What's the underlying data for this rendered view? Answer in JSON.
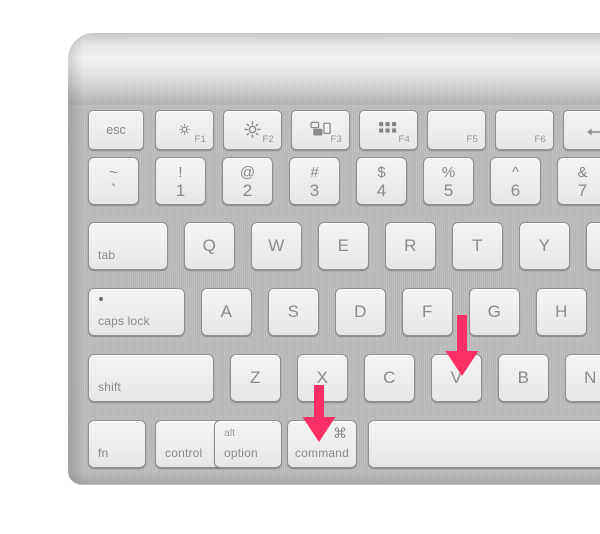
{
  "scene": {
    "subject": "apple-wireless-keyboard",
    "background_color": "#ffffff",
    "body_color": "#c4c4c5",
    "key_color": "#eeeeef",
    "legend_color": "#8a8a8c",
    "annotation_color": "#fb2f65"
  },
  "annotations": [
    {
      "name": "arrow-to-v-key",
      "points_to": "V",
      "direction": "down",
      "color": "#fb2f65"
    },
    {
      "name": "arrow-to-command-key",
      "points_to": "command",
      "direction": "down",
      "color": "#fb2f65"
    }
  ],
  "rows": {
    "function_row": [
      {
        "name": "esc",
        "label": "esc",
        "type": "word-center"
      },
      {
        "name": "f1",
        "label": "",
        "fnum": "F1",
        "icon": "brightness-down-icon",
        "type": "fkey"
      },
      {
        "name": "f2",
        "label": "",
        "fnum": "F2",
        "icon": "brightness-up-icon",
        "type": "fkey"
      },
      {
        "name": "f3",
        "label": "",
        "fnum": "F3",
        "icon": "mission-control-icon",
        "type": "fkey"
      },
      {
        "name": "f4",
        "label": "",
        "fnum": "F4",
        "icon": "launchpad-icon",
        "type": "fkey"
      },
      {
        "name": "f5",
        "label": "",
        "fnum": "F5",
        "icon": "",
        "type": "fkey"
      },
      {
        "name": "f6",
        "label": "",
        "fnum": "F6",
        "icon": "",
        "type": "fkey"
      },
      {
        "name": "delete",
        "label": "",
        "fnum": "",
        "icon": "delete-left-icon",
        "type": "fkey"
      }
    ],
    "number_row": [
      {
        "name": "backtick",
        "upper": "~",
        "lower": "`"
      },
      {
        "name": "one",
        "upper": "!",
        "lower": "1"
      },
      {
        "name": "two",
        "upper": "@",
        "lower": "2"
      },
      {
        "name": "three",
        "upper": "#",
        "lower": "3"
      },
      {
        "name": "four",
        "upper": "$",
        "lower": "4"
      },
      {
        "name": "five",
        "upper": "%",
        "lower": "5"
      },
      {
        "name": "six",
        "upper": "^",
        "lower": "6"
      },
      {
        "name": "seven",
        "upper": "&",
        "lower": "7"
      }
    ],
    "qwerty_row": {
      "modifier": {
        "name": "tab",
        "label": "tab"
      },
      "keys": [
        "Q",
        "W",
        "E",
        "R",
        "T",
        "Y"
      ]
    },
    "home_row": {
      "modifier": {
        "name": "caps-lock",
        "label": "caps lock",
        "has_led": true
      },
      "keys": [
        "A",
        "S",
        "D",
        "F",
        "G",
        "H"
      ]
    },
    "shift_row": {
      "modifier": {
        "name": "shift",
        "label": "shift"
      },
      "keys": [
        "Z",
        "X",
        "C",
        "V",
        "B",
        "N"
      ]
    },
    "bottom_row": [
      {
        "name": "fn",
        "label": "fn",
        "sublabel": "",
        "symbol": ""
      },
      {
        "name": "control",
        "label": "control",
        "sublabel": "",
        "symbol": ""
      },
      {
        "name": "option",
        "label": "option",
        "sublabel": "alt",
        "symbol": ""
      },
      {
        "name": "command",
        "label": "command",
        "sublabel": "",
        "symbol": "⌘"
      },
      {
        "name": "space",
        "label": "",
        "sublabel": "",
        "symbol": ""
      }
    ]
  }
}
